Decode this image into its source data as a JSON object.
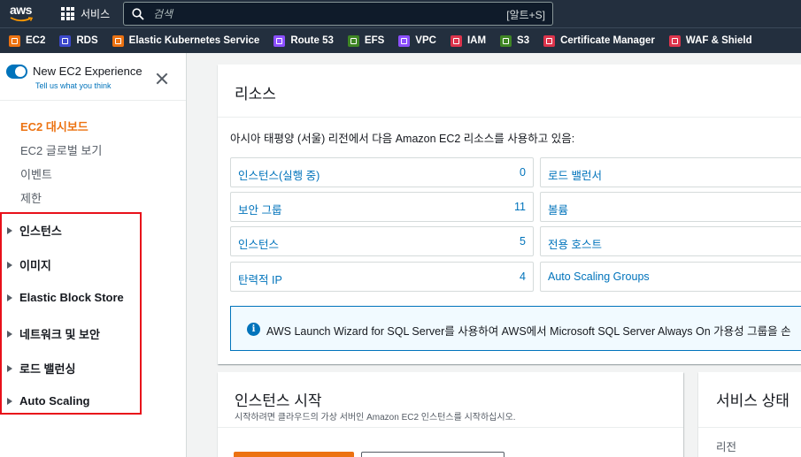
{
  "topnav": {
    "logo": "aws",
    "services_label": "서비스",
    "search_placeholder": "검색",
    "search_shortcut": "[알트+S]"
  },
  "favorites": [
    {
      "label": "EC2",
      "color": "#ec7211",
      "icon": "ec2-icon"
    },
    {
      "label": "RDS",
      "color": "#3b48cc",
      "icon": "rds-icon"
    },
    {
      "label": "Elastic Kubernetes Service",
      "color": "#ec7211",
      "icon": "eks-icon"
    },
    {
      "label": "Route 53",
      "color": "#8c4fff",
      "icon": "route53-icon"
    },
    {
      "label": "EFS",
      "color": "#3f8624",
      "icon": "efs-icon"
    },
    {
      "label": "VPC",
      "color": "#8c4fff",
      "icon": "vpc-icon"
    },
    {
      "label": "IAM",
      "color": "#dd344c",
      "icon": "iam-icon"
    },
    {
      "label": "S3",
      "color": "#3f8624",
      "icon": "s3-icon"
    },
    {
      "label": "Certificate Manager",
      "color": "#dd344c",
      "icon": "acm-icon"
    },
    {
      "label": "WAF & Shield",
      "color": "#dd344c",
      "icon": "waf-icon"
    }
  ],
  "sidebar": {
    "experience_title": "New EC2 Experience",
    "experience_link": "Tell us what you think",
    "links": [
      {
        "label": "EC2 대시보드",
        "active": true
      },
      {
        "label": "EC2 글로벌 보기",
        "active": false
      },
      {
        "label": "이벤트",
        "active": false
      },
      {
        "label": "제한",
        "active": false
      }
    ],
    "groups": [
      {
        "label": "인스턴스"
      },
      {
        "label": "이미지"
      },
      {
        "label": "Elastic Block Store"
      },
      {
        "label": "네트워크 및 보안"
      },
      {
        "label": "로드 밸런싱"
      },
      {
        "label": "Auto Scaling"
      }
    ]
  },
  "resources": {
    "title": "리소스",
    "description": "아시아 태평양 (서울) 리전에서 다음 Amazon EC2 리소스를 사용하고 있음:",
    "items": [
      {
        "label": "인스턴스(실행 중)",
        "count": "0"
      },
      {
        "label": "로드 밸런서",
        "count": ""
      },
      {
        "label": "보안 그룹",
        "count": "11"
      },
      {
        "label": "볼륨",
        "count": ""
      },
      {
        "label": "인스턴스",
        "count": "5"
      },
      {
        "label": "전용 호스트",
        "count": ""
      },
      {
        "label": "탄력적 IP",
        "count": "4"
      },
      {
        "label": "Auto Scaling Groups",
        "count": ""
      }
    ],
    "info_text": "AWS Launch Wizard for SQL Server를 사용하여 AWS에서 Microsoft SQL Server Always On 가용성 그룹을 손"
  },
  "launch": {
    "title": "인스턴스 시작",
    "subtitle": "시작하려면 클라우드의 가상 서버인 Amazon EC2 인스턴스를 시작하십시오."
  },
  "service_status": {
    "title": "서비스 상태",
    "region_label": "리전"
  }
}
